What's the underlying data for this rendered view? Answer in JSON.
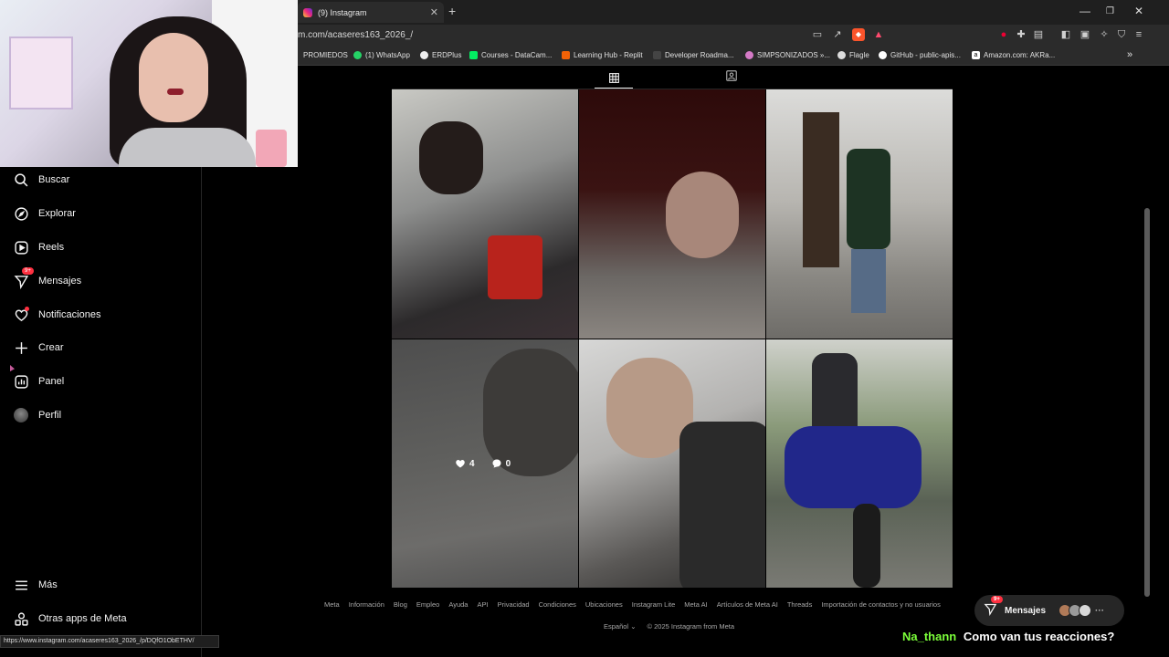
{
  "browser": {
    "tab_title": "(9) Instagram",
    "url": "m.com/acaseres163_2026_/",
    "bookmarks": [
      "PROMIEDOS",
      "(1) WhatsApp",
      "ERDPlus",
      "Courses - DataCam...",
      "Learning Hub - Replit",
      "Developer Roadma...",
      "SIMPSONIZADOS »...",
      "Flagle",
      "GitHub - public-apis...",
      "Amazon.com: AKRa..."
    ],
    "status_url": "https://www.instagram.com/acaseres163_2026_/p/DQfO1ObETHV/"
  },
  "sidebar": {
    "items": [
      {
        "label": "Buscar",
        "icon": "search-icon"
      },
      {
        "label": "Explorar",
        "icon": "compass-icon"
      },
      {
        "label": "Reels",
        "icon": "reels-icon"
      },
      {
        "label": "Mensajes",
        "icon": "messenger-icon",
        "badge": "9+"
      },
      {
        "label": "Notificaciones",
        "icon": "heart-icon"
      },
      {
        "label": "Crear",
        "icon": "plus-icon"
      },
      {
        "label": "Panel",
        "icon": "dashboard-icon"
      },
      {
        "label": "Perfil",
        "icon": "avatar-icon"
      }
    ],
    "more_label": "Más",
    "meta_apps_label": "Otras apps de Meta"
  },
  "post_hover": {
    "likes": "4",
    "comments": "0"
  },
  "footer": {
    "links": [
      "Meta",
      "Información",
      "Blog",
      "Empleo",
      "Ayuda",
      "API",
      "Privacidad",
      "Condiciones",
      "Ubicaciones",
      "Instagram Lite",
      "Meta AI",
      "Artículos de Meta AI",
      "Threads",
      "Importación de contactos y no usuarios"
    ],
    "language": "Español",
    "copyright": "© 2025 Instagram from Meta"
  },
  "messages_pill": {
    "label": "Mensajes",
    "badge": "9+"
  },
  "stream_chat": {
    "user": "Na_thann",
    "message": "Como van tus reacciones?",
    "user_color": "#7cff3a"
  }
}
